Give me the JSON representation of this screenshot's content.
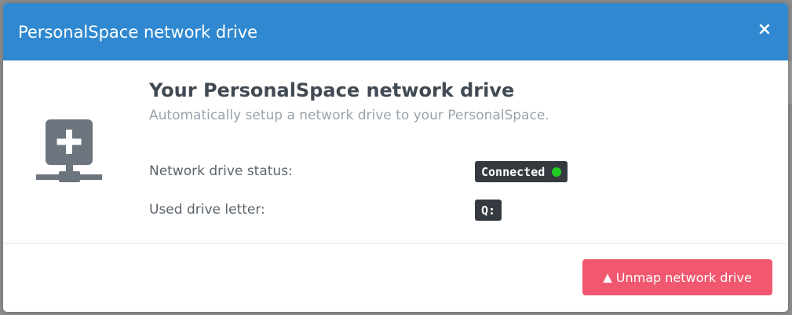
{
  "modal": {
    "title": "PersonalSpace network drive",
    "close_glyph": "×"
  },
  "body": {
    "icon": "network-drive-icon",
    "heading": "Your PersonalSpace network drive",
    "subheading": "Automatically setup a network drive to your PersonalSpace.",
    "rows": [
      {
        "label": "Network drive status:",
        "value": "Connected"
      },
      {
        "label": "Used drive letter:",
        "value": "Q:"
      }
    ]
  },
  "footer": {
    "unmap_label": "Unmap network drive",
    "unmap_icon": "warning-icon",
    "unmap_icon_glyph": "▲"
  },
  "colors": {
    "header": "#3089d0",
    "badge": "#343a40",
    "connected_dot": "#22cc22",
    "danger_button": "#f1586f",
    "icon_gray": "#6c757d"
  }
}
